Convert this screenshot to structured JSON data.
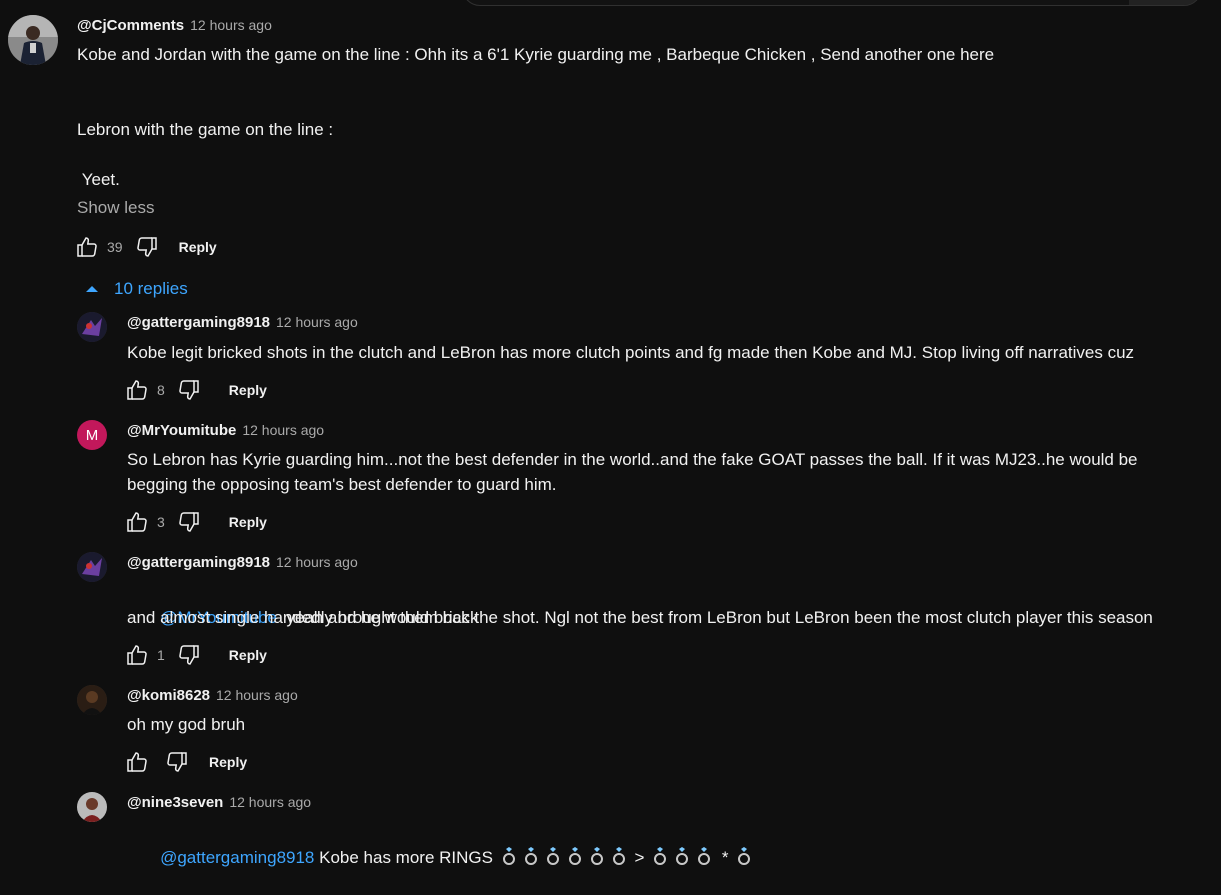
{
  "top_comment": {
    "author": "@CjComments",
    "time": "12 hours ago",
    "line1": "Kobe and Jordan with the game on the line : Ohh its a 6'1 Kyrie guarding me , Barbeque Chicken , Send another one here",
    "line2": "Lebron with the game on the line :",
    "line3": " Yeet.",
    "show_less": "Show less",
    "likes": "39",
    "reply_label": "Reply",
    "replies_toggle": "10 replies"
  },
  "replies": [
    {
      "author": "@gattergaming8918",
      "time": "12 hours ago",
      "text": "Kobe legit bricked shots in the clutch and LeBron has more clutch points and fg made then Kobe and MJ. Stop living off narratives cuz",
      "likes": "8",
      "reply_label": "Reply"
    },
    {
      "author": "@MrYoumitube",
      "avatar_letter": "M",
      "time": "12 hours ago",
      "text": "So Lebron has Kyrie guarding him...not the best defender in the world..and the fake GOAT passes the ball. If it was MJ23..he would be\nbegging the opposing team's best defender to guard him.",
      "likes": "3",
      "reply_label": "Reply"
    },
    {
      "author": "@gattergaming8918",
      "time": "12 hours ago",
      "mention": "@MrYoumitube",
      "text_after_mention": "  yeah and he would brick the shot. Ngl not the best from LeBron but LeBron been the most clutch player this season",
      "text_line2": "and almost single handedly brought them back",
      "likes": "1",
      "reply_label": "Reply"
    },
    {
      "author": "@komi8628",
      "time": "12 hours ago",
      "text": "oh my god bruh",
      "likes": "",
      "reply_label": "Reply"
    },
    {
      "author": "@nine3seven",
      "time": "12 hours ago",
      "mention": "@gattergaming8918",
      "text_after_mention": " Kobe has more RINGS",
      "gt": ">",
      "star": "*"
    }
  ],
  "colors": {
    "background": "#0f0f0f",
    "link": "#3ea6ff",
    "secondary_text": "#aaaaaa",
    "avatar_m": "#c2185b"
  },
  "icons": [
    "thumb-up-icon",
    "thumb-down-icon",
    "chevron-up-icon",
    "ring-emoji-icon"
  ]
}
